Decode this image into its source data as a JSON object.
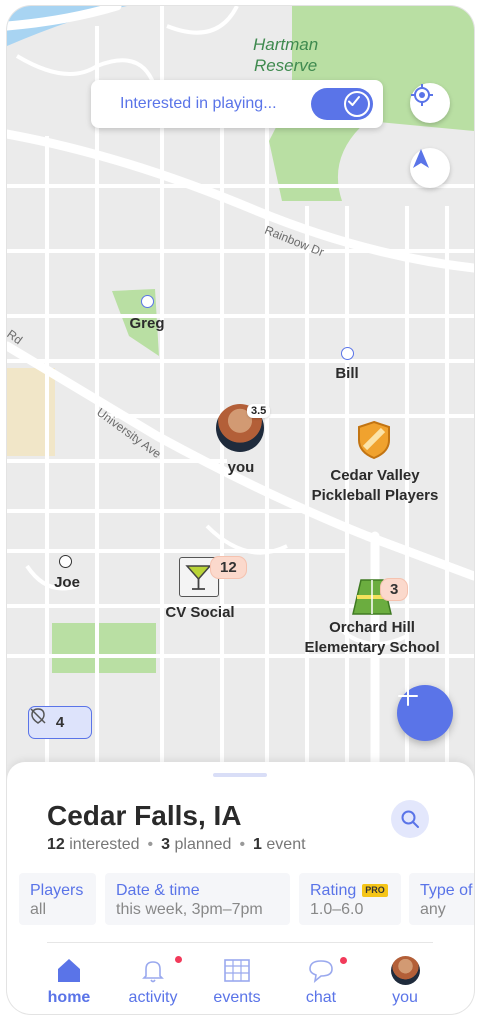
{
  "map": {
    "park_label": "Hartman\nReserve",
    "roads": {
      "rainbow": "Rainbow Dr",
      "university": "University Ave",
      "rd": "Rd"
    }
  },
  "toggle": {
    "label": "Interested in playing...",
    "on": true
  },
  "map_buttons": {
    "locate_icon": "crosshair-icon",
    "navigate_icon": "navigation-arrow-icon"
  },
  "markers": {
    "greg": "Greg",
    "bill": "Bill",
    "you": {
      "label": "you",
      "rating": "3.5"
    },
    "club": {
      "label": "Cedar Valley\nPickleball Players",
      "icon": "shield-icon"
    },
    "joe": "Joe",
    "social": {
      "label": "CV Social",
      "count": "12",
      "icon": "cocktail-icon"
    },
    "school": {
      "label": "Orchard Hill\nElementary School",
      "count": "3",
      "icon": "court-icon"
    }
  },
  "hidden_chip": {
    "count": "4",
    "icon": "hidden-location-icon"
  },
  "fab": {
    "icon": "plus-icon"
  },
  "sheet": {
    "title": "Cedar Falls, IA",
    "stats": [
      {
        "value": "12",
        "label": "interested"
      },
      {
        "value": "3",
        "label": "planned"
      },
      {
        "value": "1",
        "label": "event"
      }
    ],
    "filters": [
      {
        "title": "Players",
        "value": "all"
      },
      {
        "title": "Date & time",
        "value": "this week, 3pm–7pm"
      },
      {
        "title": "Rating",
        "value": "1.0–6.0",
        "badge": "PRO"
      },
      {
        "title": "Type of",
        "value": "any"
      }
    ]
  },
  "nav": [
    {
      "label": "home",
      "icon": "home-icon",
      "active": true
    },
    {
      "label": "activity",
      "icon": "bell-icon",
      "notification": true
    },
    {
      "label": "events",
      "icon": "calendar-icon"
    },
    {
      "label": "chat",
      "icon": "chat-icon",
      "notification": true
    },
    {
      "label": "you",
      "icon": "avatar"
    }
  ],
  "colors": {
    "accent": "#5a74e8",
    "park": "#b9dfa3",
    "notification": "#f23a5a"
  }
}
